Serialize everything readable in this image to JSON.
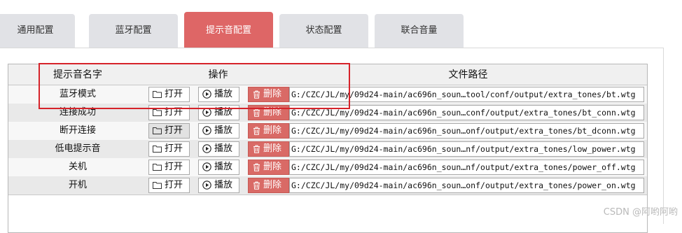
{
  "tabs": [
    {
      "label": "通用配置",
      "active": false
    },
    {
      "label": "蓝牙配置",
      "active": false
    },
    {
      "label": "提示音配置",
      "active": true
    },
    {
      "label": "状态配置",
      "active": false
    },
    {
      "label": "联合音量",
      "active": false
    }
  ],
  "table": {
    "headers": {
      "name": "提示音名字",
      "action": "操作",
      "path": "文件路径"
    },
    "open_label": "打开",
    "play_label": "播放",
    "delete_label": "删除",
    "rows": [
      {
        "name": "蓝牙模式",
        "path": "G:/CZC/JL/my/09d24-main/ac696n_soun…tool/conf/output/extra_tones/bt.wtg"
      },
      {
        "name": "连接成功",
        "path": "G:/CZC/JL/my/09d24-main/ac696n_soun…conf/output/extra_tones/bt_conn.wtg"
      },
      {
        "name": "断开连接",
        "path": "G:/CZC/JL/my/09d24-main/ac696n_soun…onf/output/extra_tones/bt_dconn.wtg"
      },
      {
        "name": "低电提示音",
        "path": "G:/CZC/JL/my/09d24-main/ac696n_soun…nf/output/extra_tones/low_power.wtg"
      },
      {
        "name": "关机",
        "path": "G:/CZC/JL/my/09d24-main/ac696n_soun…nf/output/extra_tones/power_off.wtg"
      },
      {
        "name": "开机",
        "path": "G:/CZC/JL/my/09d24-main/ac696n_soun…onf/output/extra_tones/power_on.wtg"
      }
    ]
  },
  "watermark": "CSDN @阿哟阿哟",
  "colors": {
    "accent": "#de6666",
    "delete": "#d96a66",
    "highlight_box": "#d6232a"
  }
}
